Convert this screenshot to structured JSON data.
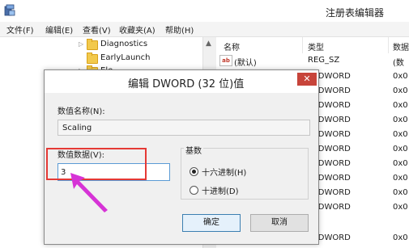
{
  "app": {
    "title": "注册表编辑器"
  },
  "menu": [
    "文件(F)",
    "编辑(E)",
    "查看(V)",
    "收藏夹(A)",
    "帮助(H)"
  ],
  "tree": {
    "items": [
      "Diagnostics",
      "EarlyLaunch",
      "Ele"
    ]
  },
  "values": {
    "headers": {
      "name": "名称",
      "type": "类型",
      "data": "数据"
    },
    "rows": [
      {
        "name": "(默认)",
        "type": "REG_SZ",
        "data": "(数"
      },
      {
        "name": "",
        "type": "G_DWORD",
        "data": "0x0"
      },
      {
        "name": "",
        "type": "G_DWORD",
        "data": "0x0"
      },
      {
        "name": "",
        "type": "G_DWORD",
        "data": "0x0"
      },
      {
        "name": "",
        "type": "G_DWORD",
        "data": "0x0"
      },
      {
        "name": "",
        "type": "G_DWORD",
        "data": "0x0"
      },
      {
        "name": "",
        "type": "G_DWORD",
        "data": "0x0"
      },
      {
        "name": "",
        "type": "G_DWORD",
        "data": "0x0"
      },
      {
        "name": "",
        "type": "G_DWORD",
        "data": "0x0"
      },
      {
        "name": "",
        "type": "G_DWORD",
        "data": "0x0"
      },
      {
        "name": "",
        "type": "G_DWORD",
        "data": "0x0"
      },
      {
        "name": "",
        "type": "G_DWORD",
        "data": "0x0"
      }
    ]
  },
  "dialog": {
    "title": "编辑 DWORD (32 位)值",
    "close": "✕",
    "name_label": "数值名称(N):",
    "name_value": "Scaling",
    "data_label": "数值数据(V):",
    "data_value": "3",
    "base_label": "基数",
    "hex_label": "十六进制(H)",
    "dec_label": "十进制(D)",
    "ok_label": "确定",
    "cancel_label": "取消"
  },
  "colors": {
    "highlight": "#e53935",
    "arrow": "#d633d6",
    "close": "#c7443a"
  }
}
